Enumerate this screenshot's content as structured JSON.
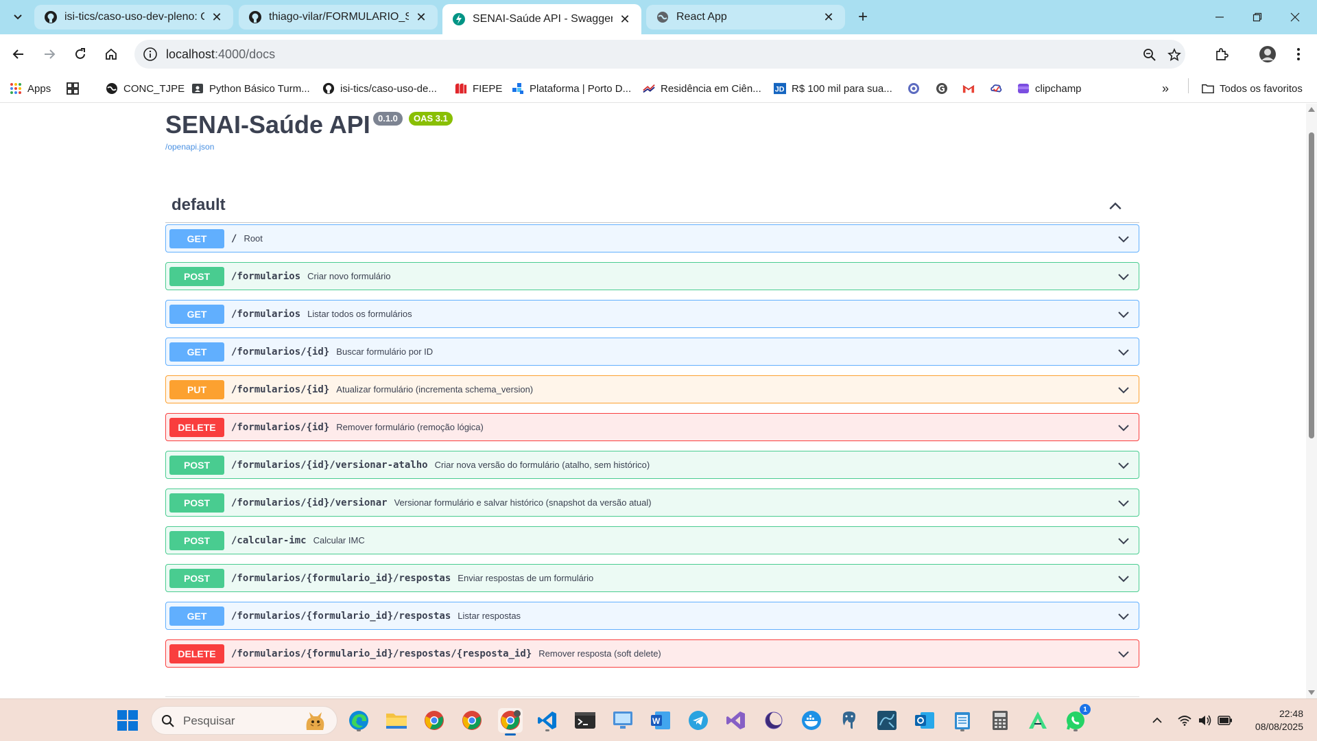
{
  "browser": {
    "tabs": [
      {
        "title": "isi-tics/caso-uso-dev-pleno: Ca",
        "icon": "github-icon",
        "active": false
      },
      {
        "title": "thiago-vilar/FORMULARIO_SEN",
        "icon": "github-icon",
        "active": false
      },
      {
        "title": "SENAI-Saúde API - Swagger UI",
        "icon": "fastapi-icon",
        "active": true
      },
      {
        "title": "React App",
        "icon": "globe-icon",
        "active": false
      }
    ],
    "url_host": "localhost",
    "url_path": ":4000/docs",
    "bookmarks": [
      {
        "label": "Apps",
        "icon": "apps-grid-icon"
      },
      {
        "label": "",
        "icon": "tab-groups-icon"
      },
      {
        "label": "CONC_TJPE",
        "icon": "globe-icon"
      },
      {
        "label": "Python Básico Turm...",
        "icon": "classroom-icon"
      },
      {
        "label": "isi-tics/caso-uso-de...",
        "icon": "github-icon"
      },
      {
        "label": "FIEPE",
        "icon": "fiepe-icon"
      },
      {
        "label": "Plataforma | Porto D...",
        "icon": "porto-digital-icon"
      },
      {
        "label": "Residência em Ciên...",
        "icon": "residencia-icon"
      },
      {
        "label": "R$ 100 mil para sua...",
        "icon": "jd-icon"
      },
      {
        "label": "",
        "icon": "settings-badge-icon"
      },
      {
        "label": "",
        "icon": "grammarly-icon"
      },
      {
        "label": "",
        "icon": "gmail-icon"
      },
      {
        "label": "",
        "icon": "nuvem-icon"
      },
      {
        "label": "clipchamp",
        "icon": "clipchamp-icon"
      }
    ],
    "all_bookmarks_label": "Todos os favoritos"
  },
  "swagger": {
    "title": "SENAI-Saúde API",
    "version": "0.1.0",
    "oas": "OAS 3.1",
    "spec_link": "/openapi.json",
    "section": "default",
    "operations": [
      {
        "method": "GET",
        "path": "/",
        "summary": "Root"
      },
      {
        "method": "POST",
        "path": "/formularios",
        "summary": "Criar novo formulário"
      },
      {
        "method": "GET",
        "path": "/formularios",
        "summary": "Listar todos os formulários"
      },
      {
        "method": "GET",
        "path": "/formularios/{id}",
        "summary": "Buscar formulário por ID"
      },
      {
        "method": "PUT",
        "path": "/formularios/{id}",
        "summary": "Atualizar formulário (incrementa schema_version)"
      },
      {
        "method": "DELETE",
        "path": "/formularios/{id}",
        "summary": "Remover formulário (remoção lógica)"
      },
      {
        "method": "POST",
        "path": "/formularios/{id}/versionar-atalho",
        "summary": "Criar nova versão do formulário (atalho, sem histórico)"
      },
      {
        "method": "POST",
        "path": "/formularios/{id}/versionar",
        "summary": "Versionar formulário e salvar histórico (snapshot da versão atual)"
      },
      {
        "method": "POST",
        "path": "/calcular-imc",
        "summary": "Calcular IMC"
      },
      {
        "method": "POST",
        "path": "/formularios/{formulario_id}/respostas",
        "summary": "Enviar respostas de um formulário"
      },
      {
        "method": "GET",
        "path": "/formularios/{formulario_id}/respostas",
        "summary": "Listar respostas"
      },
      {
        "method": "DELETE",
        "path": "/formularios/{formulario_id}/respostas/{resposta_id}",
        "summary": "Remover resposta (soft delete)"
      }
    ]
  },
  "taskbar": {
    "search_label": "Pesquisar",
    "apps": [
      "edge-icon",
      "file-explorer-icon",
      "chrome-icon",
      "chrome-icon",
      "chrome-icon",
      "vscode-icon",
      "terminal-icon",
      "remote-desktop-icon",
      "word-icon",
      "telegram-icon",
      "visual-studio-icon",
      "eclipse-icon",
      "docker-icon",
      "postgres-icon",
      "mysql-workbench-icon",
      "outlook-icon",
      "notepad-icon",
      "calculator-icon",
      "android-studio-icon",
      "whatsapp-icon"
    ],
    "whatsapp_badge": "1",
    "time": "22:48",
    "date": "08/08/2025"
  },
  "colors": {
    "get": "#61affe",
    "post": "#49cc90",
    "put": "#fca130",
    "delete": "#f93e3e",
    "tabstrip": "#a9dff1",
    "taskbar": "#f3dfd6"
  }
}
